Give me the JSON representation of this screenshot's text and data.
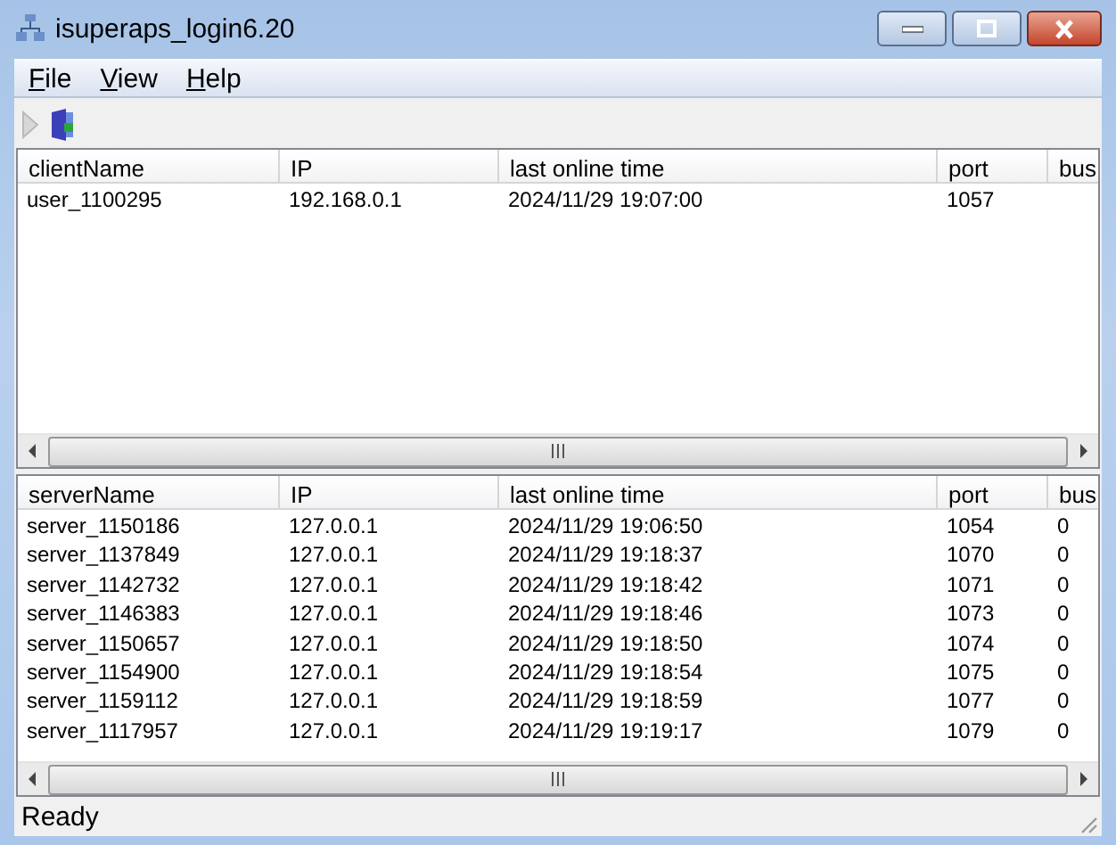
{
  "window": {
    "title": "isuperaps_login6.20"
  },
  "menu": [
    {
      "label": "File"
    },
    {
      "label": "View"
    },
    {
      "label": "Help"
    }
  ],
  "toolbar": [
    {
      "kind": "play",
      "disabled": true
    },
    {
      "kind": "exit",
      "disabled": false
    }
  ],
  "client_table": {
    "columns": [
      "clientName",
      "IP",
      "last online time",
      "port",
      "bus"
    ],
    "rows": [
      [
        "user_1100295",
        "192.168.0.1",
        "2024/11/29 19:07:00",
        "1057",
        ""
      ]
    ]
  },
  "server_table": {
    "columns": [
      "serverName",
      "IP",
      "last online time",
      "port",
      "bus"
    ],
    "rows": [
      [
        "server_1150186",
        "127.0.0.1",
        "2024/11/29 19:06:50",
        "1054",
        "0"
      ],
      [
        "server_1137849",
        "127.0.0.1",
        "2024/11/29 19:18:37",
        "1070",
        "0"
      ],
      [
        "server_1142732",
        "127.0.0.1",
        "2024/11/29 19:18:42",
        "1071",
        "0"
      ],
      [
        "server_1146383",
        "127.0.0.1",
        "2024/11/29 19:18:46",
        "1073",
        "0"
      ],
      [
        "server_1150657",
        "127.0.0.1",
        "2024/11/29 19:18:50",
        "1074",
        "0"
      ],
      [
        "server_1154900",
        "127.0.0.1",
        "2024/11/29 19:18:54",
        "1075",
        "0"
      ],
      [
        "server_1159112",
        "127.0.0.1",
        "2024/11/29 19:18:59",
        "1077",
        "0"
      ],
      [
        "server_1117957",
        "127.0.0.1",
        "2024/11/29 19:19:17",
        "1079",
        "0"
      ]
    ]
  },
  "status_bar": {
    "text": "Ready"
  }
}
